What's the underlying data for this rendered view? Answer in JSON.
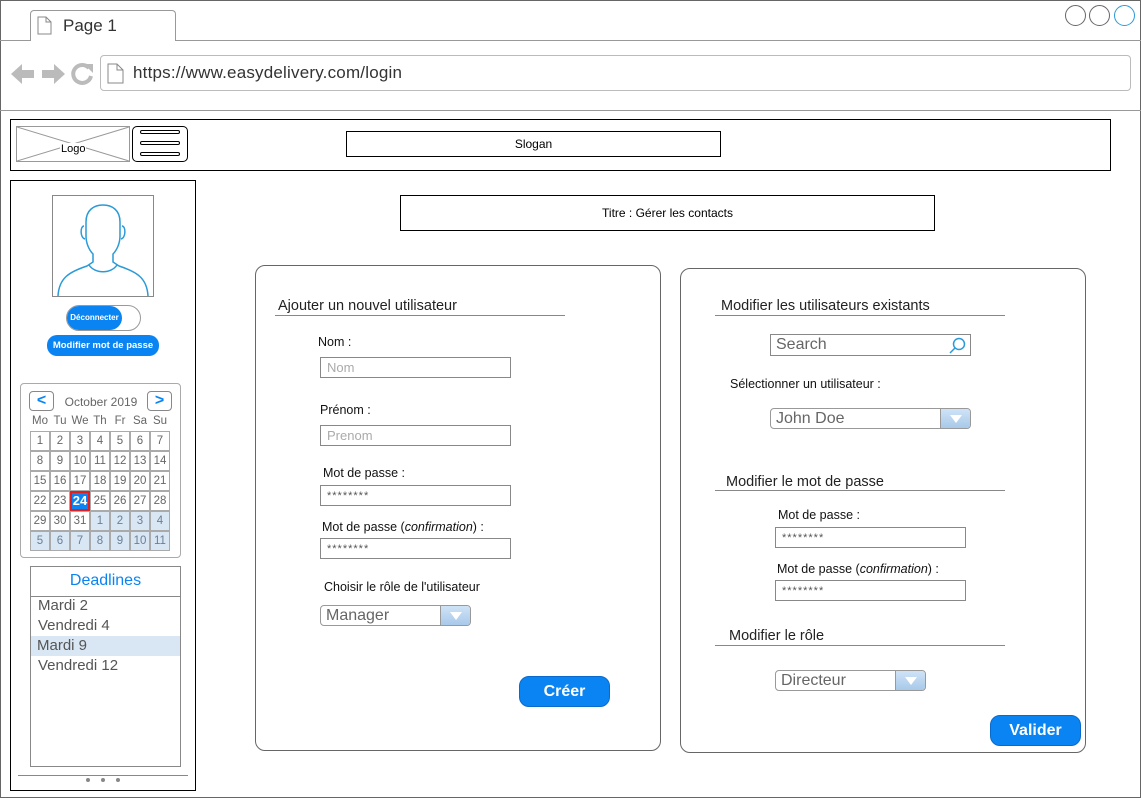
{
  "browser": {
    "tab_title": "Page 1",
    "url": "https://www.easydelivery.com/login"
  },
  "header": {
    "logo_label": "Logo",
    "slogan": "Slogan"
  },
  "sidebar": {
    "disconnect_label": "Déconnecter",
    "change_password_label": "Modifier mot de passe",
    "calendar": {
      "month_label": "October 2019",
      "prev_label": "<",
      "next_label": ">",
      "weekdays": [
        "Mo",
        "Tu",
        "We",
        "Th",
        "Fr",
        "Sa",
        "Su"
      ],
      "weeks": [
        [
          "1",
          "2",
          "3",
          "4",
          "5",
          "6",
          "7"
        ],
        [
          "8",
          "9",
          "10",
          "11",
          "12",
          "13",
          "14"
        ],
        [
          "15",
          "16",
          "17",
          "18",
          "19",
          "20",
          "21"
        ],
        [
          "22",
          "23",
          "24",
          "25",
          "26",
          "27",
          "28"
        ],
        [
          "29",
          "30",
          "31",
          "1",
          "2",
          "3",
          "4"
        ],
        [
          "5",
          "6",
          "7",
          "8",
          "9",
          "10",
          "11"
        ]
      ],
      "selected_day": "24"
    },
    "deadlines": {
      "title": "Deadlines",
      "items": [
        "Mardi 2",
        "Vendredi 4",
        "Mardi 9",
        "Vendredi 12"
      ],
      "highlighted_item": "Mardi 9"
    }
  },
  "main": {
    "title": "Titre : Gérer les contacts"
  },
  "add_panel": {
    "section_title": "Ajouter un nouvel utilisateur",
    "nom_label": "Nom :",
    "nom_placeholder": "Nom",
    "prenom_label": "Prénom :",
    "prenom_placeholder": "Prenom",
    "password_label": "Mot de passe :",
    "password_value": "********",
    "confirm_label_prefix": "Mot de passe (",
    "confirm_label_italic": "confirmation",
    "confirm_label_suffix": ") :",
    "confirm_value": "********",
    "role_label": "Choisir le rôle de l'utilisateur",
    "role_selected": "Manager",
    "create_button": "Créer"
  },
  "edit_panel": {
    "section_title": "Modifier les utilisateurs existants",
    "search_placeholder": "Search",
    "select_user_label": "Sélectionner un utilisateur :",
    "selected_user": "John Doe",
    "password_section_title": "Modifier le mot de passe",
    "password_label": "Mot de passe :",
    "password_value": "********",
    "confirm_label_prefix": "Mot de passe (",
    "confirm_label_italic": "confirmation",
    "confirm_label_suffix": ") :",
    "confirm_value": "********",
    "role_section_title": "Modifier le rôle",
    "role_selected": "Directeur",
    "validate_button": "Valider"
  },
  "colors": {
    "accent": "#0a84f2",
    "calendar_today_border": "#e02020",
    "highlight": "#d9e6f4"
  }
}
